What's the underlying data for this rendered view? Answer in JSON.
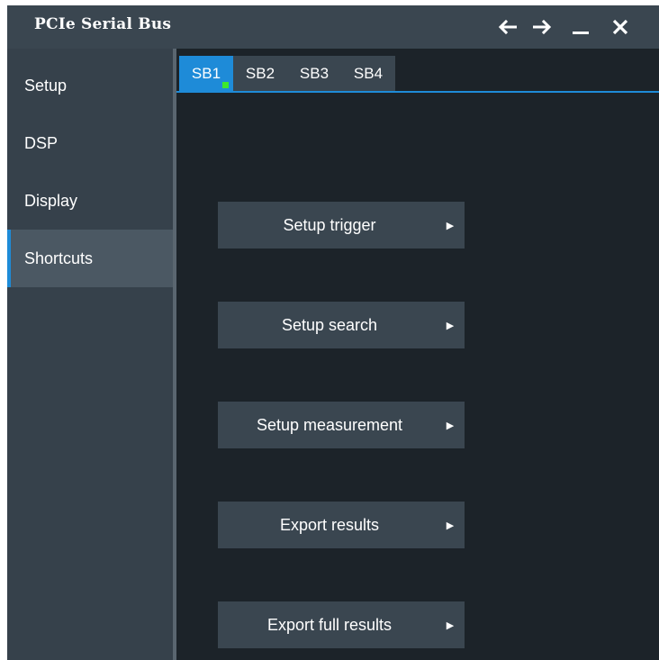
{
  "window": {
    "title": "PCIe Serial Bus",
    "controls": {
      "back_icon": "arrow-left-icon",
      "forward_icon": "arrow-right-icon",
      "minimize_icon": "minimize-icon",
      "close_icon": "close-icon"
    }
  },
  "sidebar": {
    "items": [
      {
        "label": "Setup",
        "active": false
      },
      {
        "label": "DSP",
        "active": false
      },
      {
        "label": "Display",
        "active": false
      },
      {
        "label": "Shortcuts",
        "active": true
      }
    ]
  },
  "tabs": [
    {
      "label": "SB1",
      "active": true,
      "indicator": true
    },
    {
      "label": "SB2",
      "active": false
    },
    {
      "label": "SB3",
      "active": false
    },
    {
      "label": "SB4",
      "active": false
    }
  ],
  "shortcuts": [
    {
      "label": "Setup trigger"
    },
    {
      "label": "Setup search"
    },
    {
      "label": "Setup measurement"
    },
    {
      "label": "Export results"
    },
    {
      "label": "Export full results"
    }
  ],
  "colors": {
    "accent": "#1e8bd8",
    "indicator": "#3ee82e",
    "titlebar": "#3a4650",
    "sidebar": "#36414b",
    "content": "#1c2329"
  }
}
